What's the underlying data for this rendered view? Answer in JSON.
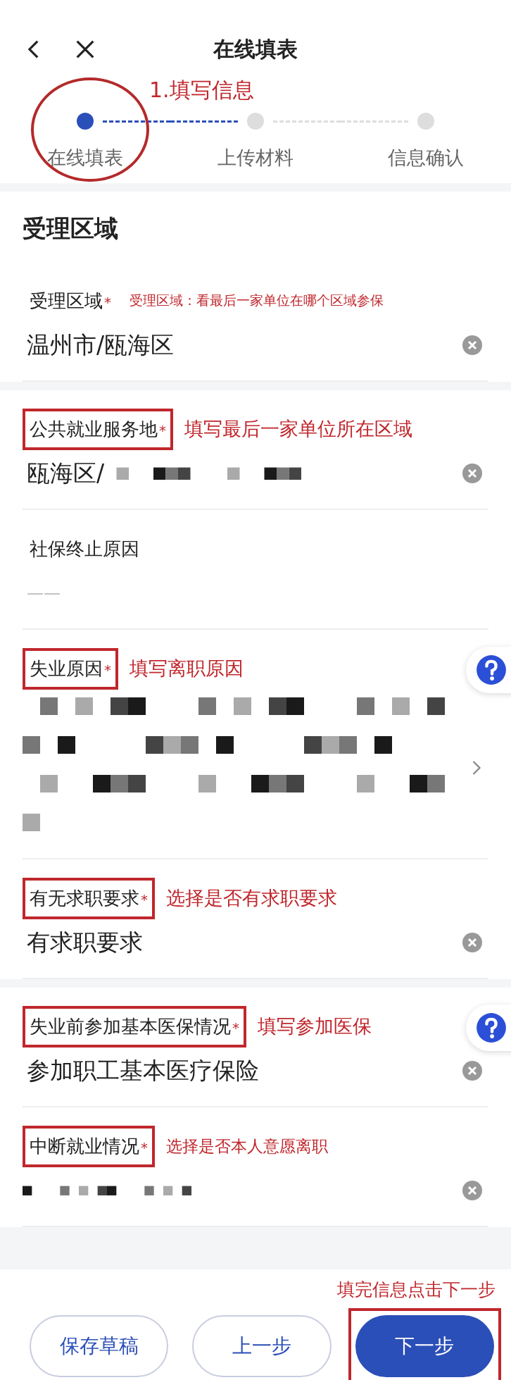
{
  "header": {
    "title": "在线填表"
  },
  "steps": {
    "annotation": "1.填写信息",
    "items": [
      {
        "label": "在线填表",
        "selected": true,
        "circled": true
      },
      {
        "label": "上传材料",
        "selected": false,
        "circled": false
      },
      {
        "label": "信息确认",
        "selected": false,
        "circled": false
      }
    ]
  },
  "sections": [
    {
      "title": "受理区域",
      "fields": [
        {
          "kind": "clear",
          "label": "受理区域",
          "required_mark": "*",
          "boxed": false,
          "annotation": "受理区域：看最后一家单位在哪个区域参保",
          "value": "温州市/瓯海区"
        }
      ]
    },
    {
      "fields": [
        {
          "kind": "clear",
          "label": "公共就业服务地",
          "required_mark": "*",
          "boxed": true,
          "annotation": "填写最后一家单位所在区域",
          "value": "瓯海区/",
          "redacted": true
        },
        {
          "kind": "plain",
          "label": "社保终止原因",
          "boxed": false,
          "placeholder": "——"
        },
        {
          "kind": "arrow",
          "label": "失业原因",
          "required_mark": "*",
          "boxed": true,
          "annotation": "填写离职原因",
          "redacted": true,
          "help": true
        },
        {
          "kind": "clear",
          "label": "有无求职要求",
          "required_mark": "*",
          "boxed": true,
          "annotation": "选择是否有求职要求",
          "value": "有求职要求"
        }
      ]
    },
    {
      "fields": [
        {
          "kind": "clear",
          "label": "失业前参加基本医保情况",
          "required_mark": "*",
          "boxed": true,
          "annotation": "填写参加医保",
          "value": "参加职工基本医疗保险",
          "help": true
        },
        {
          "kind": "clear",
          "label": "中断就业情况",
          "required_mark": "*",
          "boxed": true,
          "annotation": "选择是否本人意愿离职",
          "redacted": true
        }
      ]
    }
  ],
  "footer": {
    "annotation": "填完信息点击下一步",
    "buttons": [
      {
        "label": "保存草稿",
        "kind": "outline",
        "boxed": false
      },
      {
        "label": "上一步",
        "kind": "outline",
        "boxed": false
      },
      {
        "label": "下一步",
        "kind": "primary",
        "boxed": true
      }
    ]
  }
}
